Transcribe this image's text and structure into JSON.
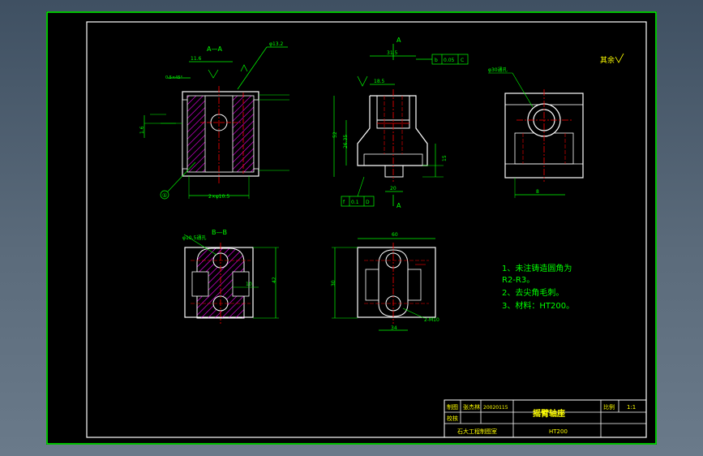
{
  "colors": {
    "background": "#000000",
    "frame": "#00ff00",
    "outline": "#ffffff",
    "centerline": "#ff0000",
    "hatch": "#ff00ff",
    "dimension": "#00ff00",
    "annotation": "#00ff00",
    "notes": "#00ff00",
    "title_text": "#ffff00"
  },
  "views": {
    "aa": {
      "label": "A—A",
      "dim_top": "11.6",
      "dim_right_bubble": "φ13.2",
      "dim_bottom": "2×φ10.5",
      "dim_left": "1.6",
      "dim_chamfer": "0.5×45°",
      "ref_balloon": "①"
    },
    "front": {
      "label_top": "A",
      "label_bottom": "A",
      "dim_top": "31.5",
      "dim_mid": "18.5",
      "dim_height": "52",
      "dim_left": "26.35",
      "dim_right": "15",
      "dim_base": "20",
      "tol_top": [
        "b",
        "0.05",
        "C"
      ],
      "tol_bottom": [
        "f",
        "0.1",
        "D"
      ]
    },
    "side": {
      "dim_hole": "φ30通孔",
      "dim_base": "8"
    },
    "bb": {
      "label": "B—B",
      "dim_hole": "φ10.5通孔",
      "dim_right": "10",
      "dim_height": "42"
    },
    "top": {
      "dim_width": "60",
      "dim_height": "30",
      "dim_bottom": "34",
      "dim_holes": "2-M10"
    }
  },
  "roughness_note": "其余",
  "notes": [
    "1、未注铸造圆角为",
    "R2-R3。",
    "2、去尖角毛刺。",
    "3、材料：HT200。"
  ],
  "title_block": {
    "labels": [
      "制图",
      "校核"
    ],
    "drawer": "张杰林",
    "number": "20020115",
    "part_name": "摇臂轴座",
    "scale_label": "比例",
    "scale_value": "1:1",
    "school": "石大工程制图室",
    "material": "HT200"
  }
}
